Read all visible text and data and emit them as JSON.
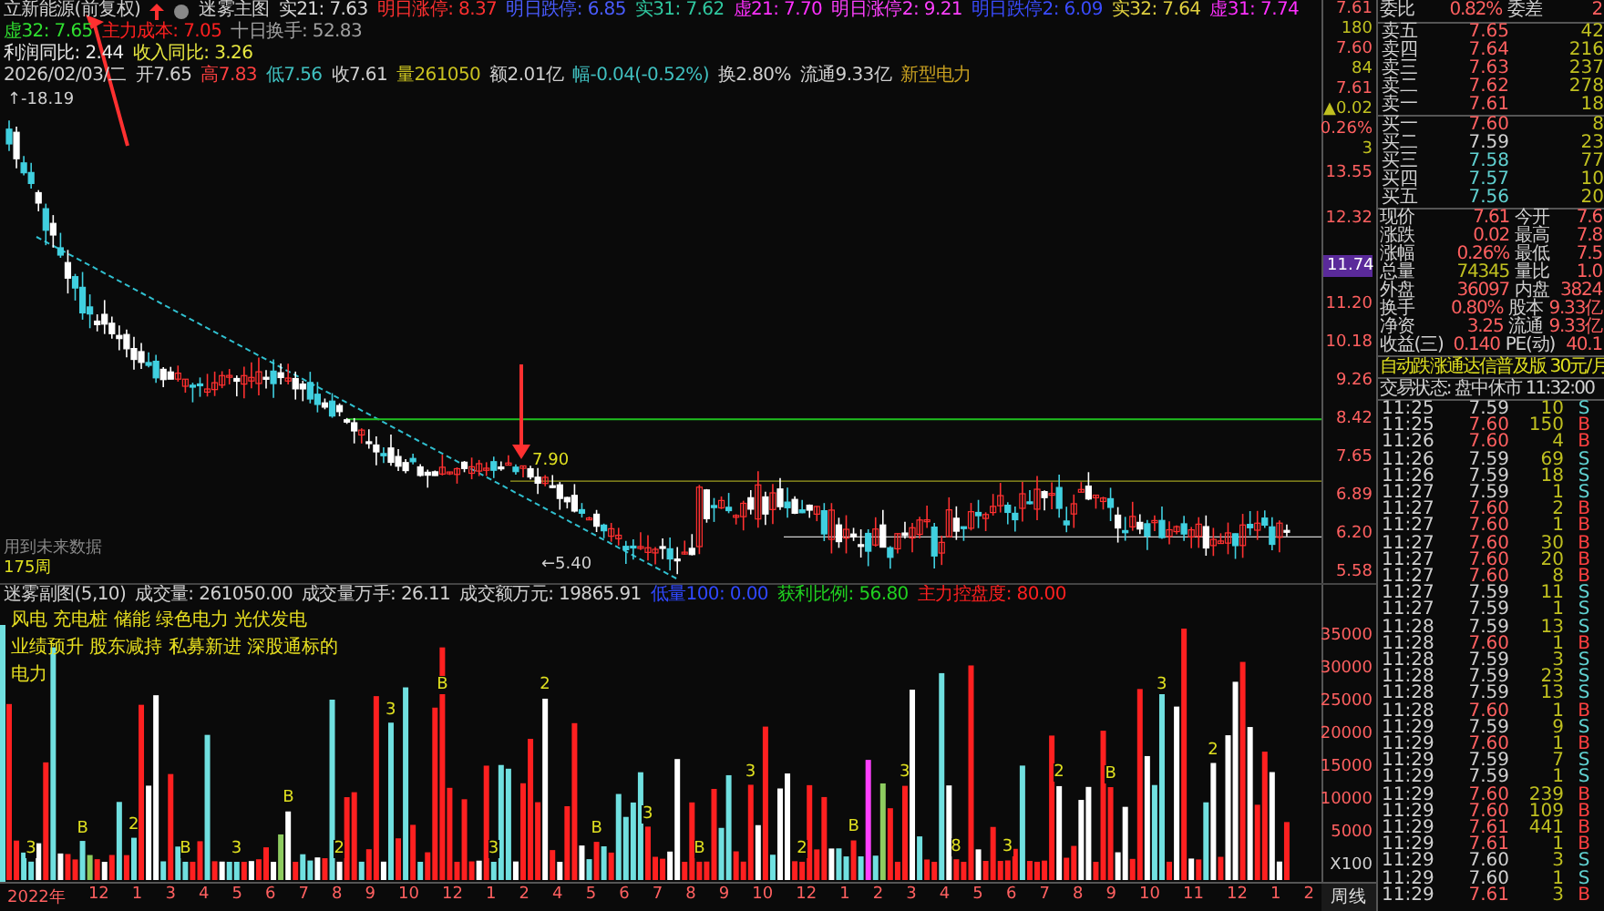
{
  "chart_header": {
    "title": "立新能源(前复权)",
    "indicator": "迷雾主图",
    "items": [
      {
        "text": "实21: 7.63",
        "color": "#d8d8d8"
      },
      {
        "text": "明日涨停: 8.37",
        "color": "#ff3030"
      },
      {
        "text": "明日跌停: 6.85",
        "color": "#4a5cff"
      },
      {
        "text": "实31: 7.62",
        "color": "#30c8a0"
      },
      {
        "text": "虚21: 7.70",
        "color": "#ff30ff"
      },
      {
        "text": "明日涨停2: 9.21",
        "color": "#ff40ff"
      },
      {
        "text": "明日跌停2: 6.09",
        "color": "#3a4cff"
      },
      {
        "text": "实32: 7.64",
        "color": "#e0d040"
      },
      {
        "text": "虚31: 7.74",
        "color": "#ff30ff"
      },
      {
        "text": "虚32: 7.65",
        "color": "#30e030"
      },
      {
        "text": "主力成本: 7.05",
        "color": "#ff2020"
      },
      {
        "text": "十日换手: 52.83",
        "color": "#a0a0a0"
      }
    ]
  },
  "line2": [
    {
      "text": "利润同比: 2.44",
      "color": "#e8e8e8"
    },
    {
      "text": "收入同比: 3.26",
      "color": "#e8e840"
    }
  ],
  "line3": [
    {
      "text": "2026/02/03/二",
      "color": "#d0d0d0"
    },
    {
      "text": "开7.65",
      "color": "#d0d0d0"
    },
    {
      "text": "高7.83",
      "color": "#ff4040"
    },
    {
      "text": "低7.56",
      "color": "#40c0c0"
    },
    {
      "text": "收7.61",
      "color": "#d0d0d0"
    },
    {
      "text": "量261050",
      "color": "#c8c020"
    },
    {
      "text": "额2.01亿",
      "color": "#d0d0d0"
    },
    {
      "text": "幅-0.04(-0.52%)",
      "color": "#40c0c0"
    },
    {
      "text": "换2.80%",
      "color": "#d0d0d0"
    },
    {
      "text": "流通9.33亿",
      "color": "#d0d0d0"
    },
    {
      "text": "新型电力",
      "color": "#c8a020"
    }
  ],
  "chart_labels": {
    "high": "↑-18.19",
    "mid": "7.90",
    "low": "←5.40",
    "future": "用到未来数据",
    "period": "175周"
  },
  "price_axis": {
    "quote": [
      "7.61",
      "180",
      "7.60",
      "84",
      "7.61",
      "▲0.02",
      "0.26%",
      "3"
    ],
    "ticks": [
      "13.55",
      "12.32",
      "11.20",
      "10.18",
      "9.26",
      "8.42",
      "7.65",
      "6.89",
      "6.20",
      "5.58"
    ],
    "current": "11.74"
  },
  "volume_header": [
    {
      "text": "迷雾副图(5,10)",
      "color": "#d0d0d0"
    },
    {
      "text": "成交量: 261050.00",
      "color": "#d0d0d0"
    },
    {
      "text": "成交量万手: 26.11",
      "color": "#d0d0d0"
    },
    {
      "text": "成交额万元: 19865.91",
      "color": "#d0d0d0"
    },
    {
      "text": "低量100: 0.00",
      "color": "#3048ff"
    },
    {
      "text": "获利比例: 56.80",
      "color": "#20d020"
    },
    {
      "text": "主力控盘度: 80.00",
      "color": "#ff2020"
    }
  ],
  "tags": [
    "风电 充电桩 储能 绿色电力 光伏发电",
    "业绩预升 股东减持 私募新进 深股通标的",
    "电力"
  ],
  "volume_marks": [
    "3",
    "B",
    "2",
    "B",
    "3",
    "B",
    "2",
    "3",
    "B",
    "3",
    "2",
    "B",
    "3",
    "B",
    "3",
    "2",
    "B",
    "3",
    "8",
    "3",
    "2",
    "B",
    "3",
    "2"
  ],
  "volume_axis": {
    "ticks": [
      "35000",
      "30000",
      "25000",
      "20000",
      "15000",
      "10000",
      "5000"
    ],
    "unit": "X100"
  },
  "timeline": {
    "year": "2022年",
    "months": [
      "12",
      "1",
      "3",
      "4",
      "5",
      "6",
      "7",
      "8",
      "9",
      "10",
      "12",
      "1",
      "2",
      "4",
      "5",
      "6",
      "7",
      "8",
      "9",
      "10",
      "12",
      "1",
      "2",
      "3",
      "4",
      "5",
      "6",
      "7",
      "8",
      "9",
      "10",
      "11",
      "12",
      "1",
      "2"
    ],
    "period_button": "周线"
  },
  "order_book": {
    "ratio": [
      "委比",
      "0.82%",
      "委差",
      "2"
    ],
    "asks": [
      {
        "label": "卖五",
        "price": "7.65",
        "vol": "42"
      },
      {
        "label": "卖四",
        "price": "7.64",
        "vol": "216"
      },
      {
        "label": "卖三",
        "price": "7.63",
        "vol": "237"
      },
      {
        "label": "卖二",
        "price": "7.62",
        "vol": "278"
      },
      {
        "label": "卖一",
        "price": "7.61",
        "vol": "18"
      }
    ],
    "bids": [
      {
        "label": "买一",
        "price": "7.60",
        "vol": "8"
      },
      {
        "label": "买二",
        "price": "7.59",
        "vol": "23"
      },
      {
        "label": "买三",
        "price": "7.58",
        "vol": "77"
      },
      {
        "label": "买四",
        "price": "7.57",
        "vol": "10"
      },
      {
        "label": "买五",
        "price": "7.56",
        "vol": "20"
      }
    ],
    "stats": [
      [
        "现价",
        "7.61",
        "今开",
        "7.6"
      ],
      [
        "涨跌",
        "0.02",
        "最高",
        "7.8"
      ],
      [
        "涨幅",
        "0.26%",
        "最低",
        "7.5"
      ],
      [
        "总量",
        "74345",
        "量比",
        "1.0"
      ],
      [
        "外盘",
        "36097",
        "内盘",
        "3824"
      ],
      [
        "换手",
        "0.80%",
        "股本",
        "9.33亿"
      ],
      [
        "净资",
        "3.25",
        "流通",
        "9.33亿"
      ],
      [
        "收益(三)",
        "0.140",
        "PE(动)",
        "40.1"
      ]
    ],
    "banner": "自动跌涨通达信普及版  30元/月",
    "status": "交易状态: 盘中休市 11:32:00"
  },
  "ticks": [
    {
      "time": "11:25",
      "price": "7.59",
      "vol": "10",
      "side": "S"
    },
    {
      "time": "11:25",
      "price": "7.60",
      "vol": "150",
      "side": "B"
    },
    {
      "time": "11:26",
      "price": "7.60",
      "vol": "4",
      "side": "B"
    },
    {
      "time": "11:26",
      "price": "7.59",
      "vol": "69",
      "side": "S"
    },
    {
      "time": "11:26",
      "price": "7.59",
      "vol": "18",
      "side": "S"
    },
    {
      "time": "11:27",
      "price": "7.59",
      "vol": "1",
      "side": "S"
    },
    {
      "time": "11:27",
      "price": "7.60",
      "vol": "2",
      "side": "B"
    },
    {
      "time": "11:27",
      "price": "7.60",
      "vol": "1",
      "side": "B"
    },
    {
      "time": "11:27",
      "price": "7.60",
      "vol": "30",
      "side": "B"
    },
    {
      "time": "11:27",
      "price": "7.60",
      "vol": "20",
      "side": "B"
    },
    {
      "time": "11:27",
      "price": "7.60",
      "vol": "8",
      "side": "B"
    },
    {
      "time": "11:27",
      "price": "7.59",
      "vol": "11",
      "side": "S"
    },
    {
      "time": "11:27",
      "price": "7.59",
      "vol": "1",
      "side": "S"
    },
    {
      "time": "11:28",
      "price": "7.59",
      "vol": "13",
      "side": "S"
    },
    {
      "time": "11:28",
      "price": "7.60",
      "vol": "1",
      "side": "B"
    },
    {
      "time": "11:28",
      "price": "7.59",
      "vol": "3",
      "side": "S"
    },
    {
      "time": "11:28",
      "price": "7.59",
      "vol": "23",
      "side": "S"
    },
    {
      "time": "11:28",
      "price": "7.59",
      "vol": "13",
      "side": "S"
    },
    {
      "time": "11:28",
      "price": "7.60",
      "vol": "1",
      "side": "B"
    },
    {
      "time": "11:29",
      "price": "7.59",
      "vol": "9",
      "side": "S"
    },
    {
      "time": "11:29",
      "price": "7.60",
      "vol": "1",
      "side": "B"
    },
    {
      "time": "11:29",
      "price": "7.59",
      "vol": "7",
      "side": "S"
    },
    {
      "time": "11:29",
      "price": "7.59",
      "vol": "1",
      "side": "S"
    },
    {
      "time": "11:29",
      "price": "7.60",
      "vol": "239",
      "side": "B"
    },
    {
      "time": "11:29",
      "price": "7.60",
      "vol": "109",
      "side": "B"
    },
    {
      "time": "11:29",
      "price": "7.61",
      "vol": "441",
      "side": "B"
    },
    {
      "time": "11:29",
      "price": "7.61",
      "vol": "1",
      "side": "B"
    },
    {
      "time": "11:29",
      "price": "7.60",
      "vol": "3",
      "side": "S"
    },
    {
      "time": "11:29",
      "price": "7.60",
      "vol": "1",
      "side": "S"
    },
    {
      "time": "11:29",
      "price": "7.61",
      "vol": "3",
      "side": "B"
    }
  ]
}
